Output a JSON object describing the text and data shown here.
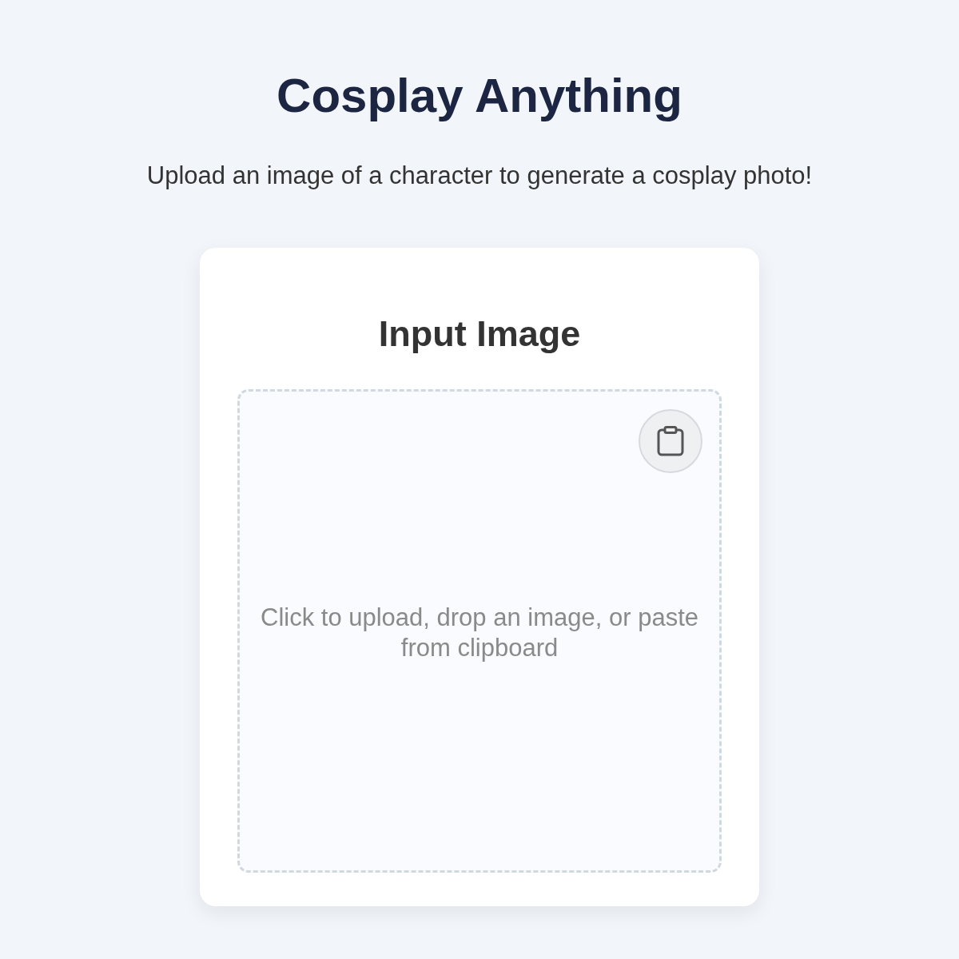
{
  "header": {
    "title": "Cosplay Anything",
    "subtitle": "Upload an image of a character to generate a cosplay photo!"
  },
  "input_panel": {
    "title": "Input Image",
    "dropzone": {
      "hint": "Click to upload, drop an image, or paste from clipboard"
    }
  }
}
